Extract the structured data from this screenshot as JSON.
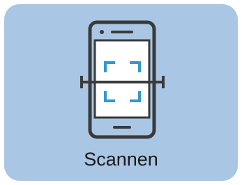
{
  "tile": {
    "label": "Scannen",
    "icon": "phone-scan-icon",
    "background": "#a9c7e4",
    "icon_stroke": "#3a3a3a",
    "icon_accent": "#3399cc"
  }
}
